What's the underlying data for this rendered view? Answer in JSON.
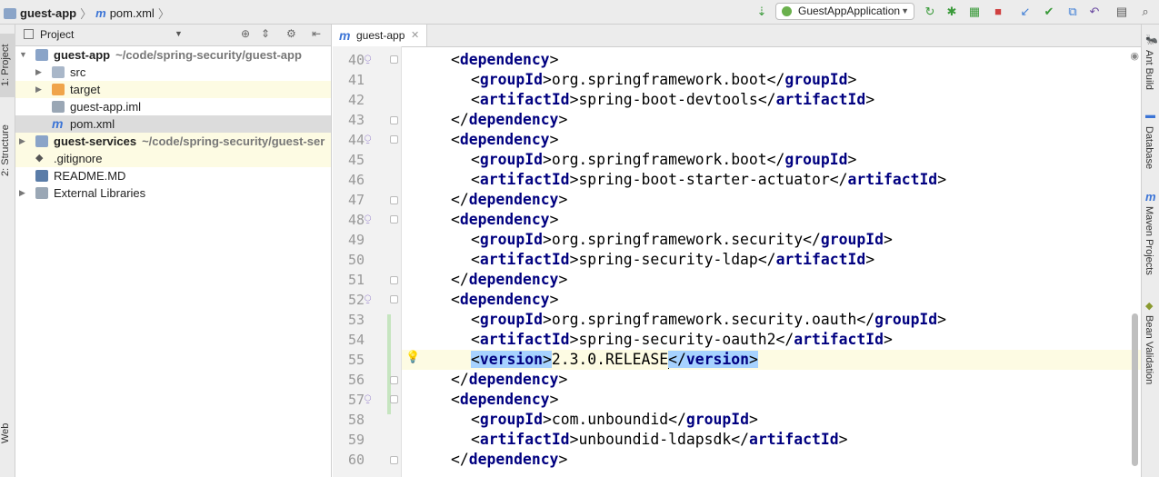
{
  "navbar": {
    "project": "guest-app",
    "file": "pom.xml",
    "run_config": "GuestAppApplication"
  },
  "colors": {
    "tag": "#000080",
    "selection": "#a6d2ff",
    "current_line": "#fdfbe3",
    "folder": "#f0a44a"
  },
  "tool_windows": {
    "left": [
      "1: Project",
      "2: Structure",
      "Web"
    ],
    "right": [
      "Ant Build",
      "Database",
      "Maven Projects",
      "Bean Validation"
    ]
  },
  "project_panel": {
    "title": "Project",
    "tree": [
      {
        "label": "guest-app",
        "path": "~/code/spring-security/guest-app",
        "bold": true,
        "indent": 0,
        "arrow": "▼",
        "icon": "module-folder-icon"
      },
      {
        "label": "src",
        "path": "",
        "bold": false,
        "indent": 1,
        "arrow": "▶",
        "icon": "folder-icon"
      },
      {
        "label": "target",
        "path": "",
        "bold": false,
        "indent": 1,
        "arrow": "▶",
        "icon": "excluded-folder-icon"
      },
      {
        "label": "guest-app.iml",
        "path": "",
        "bold": false,
        "indent": 1,
        "arrow": "",
        "icon": "iml-file-icon"
      },
      {
        "label": "pom.xml",
        "path": "",
        "bold": false,
        "indent": 1,
        "arrow": "",
        "icon": "maven-file-icon"
      },
      {
        "label": "guest-services",
        "path": "~/code/spring-security/guest-ser",
        "bold": true,
        "indent": 0,
        "arrow": "▶",
        "icon": "module-folder-icon"
      },
      {
        "label": ".gitignore",
        "path": "",
        "bold": false,
        "indent": 0,
        "arrow": "",
        "icon": "git-icon"
      },
      {
        "label": "README.MD",
        "path": "",
        "bold": false,
        "indent": 0,
        "arrow": "",
        "icon": "markdown-file-icon"
      },
      {
        "label": "External Libraries",
        "path": "",
        "bold": false,
        "indent": 0,
        "arrow": "▶",
        "icon": "libraries-icon"
      }
    ]
  },
  "editor": {
    "tab": "guest-app",
    "lines": [
      {
        "n": "40",
        "indent": 2,
        "tag": "dependency",
        "open": true,
        "text": ""
      },
      {
        "n": "41",
        "indent": 3,
        "tag": "groupId",
        "text": "org.springframework.boot"
      },
      {
        "n": "42",
        "indent": 3,
        "tag": "artifactId",
        "text": "spring-boot-devtools"
      },
      {
        "n": "43",
        "indent": 2,
        "tag": "dependency",
        "close": true,
        "text": ""
      },
      {
        "n": "44",
        "indent": 2,
        "tag": "dependency",
        "open": true,
        "text": ""
      },
      {
        "n": "45",
        "indent": 3,
        "tag": "groupId",
        "text": "org.springframework.boot"
      },
      {
        "n": "46",
        "indent": 3,
        "tag": "artifactId",
        "text": "spring-boot-starter-actuator"
      },
      {
        "n": "47",
        "indent": 2,
        "tag": "dependency",
        "close": true,
        "text": ""
      },
      {
        "n": "48",
        "indent": 2,
        "tag": "dependency",
        "open": true,
        "text": ""
      },
      {
        "n": "49",
        "indent": 3,
        "tag": "groupId",
        "text": "org.springframework.security"
      },
      {
        "n": "50",
        "indent": 3,
        "tag": "artifactId",
        "text": "spring-security-ldap"
      },
      {
        "n": "51",
        "indent": 2,
        "tag": "dependency",
        "close": true,
        "text": ""
      },
      {
        "n": "52",
        "indent": 2,
        "tag": "dependency",
        "open": true,
        "text": ""
      },
      {
        "n": "53",
        "indent": 3,
        "tag": "groupId",
        "text": "org.springframework.security.oauth"
      },
      {
        "n": "54",
        "indent": 3,
        "tag": "artifactId",
        "text": "spring-security-oauth2"
      },
      {
        "n": "55",
        "indent": 3,
        "tag": "version",
        "text": "2.3.0.RELEASE",
        "current": true
      },
      {
        "n": "56",
        "indent": 2,
        "tag": "dependency",
        "close": true,
        "text": ""
      },
      {
        "n": "57",
        "indent": 2,
        "tag": "dependency",
        "open": true,
        "text": ""
      },
      {
        "n": "58",
        "indent": 3,
        "tag": "groupId",
        "text": "com.unboundid"
      },
      {
        "n": "59",
        "indent": 3,
        "tag": "artifactId",
        "text": "unboundid-ldapsdk"
      },
      {
        "n": "60",
        "indent": 2,
        "tag": "dependency",
        "close": true,
        "text": ""
      }
    ]
  }
}
